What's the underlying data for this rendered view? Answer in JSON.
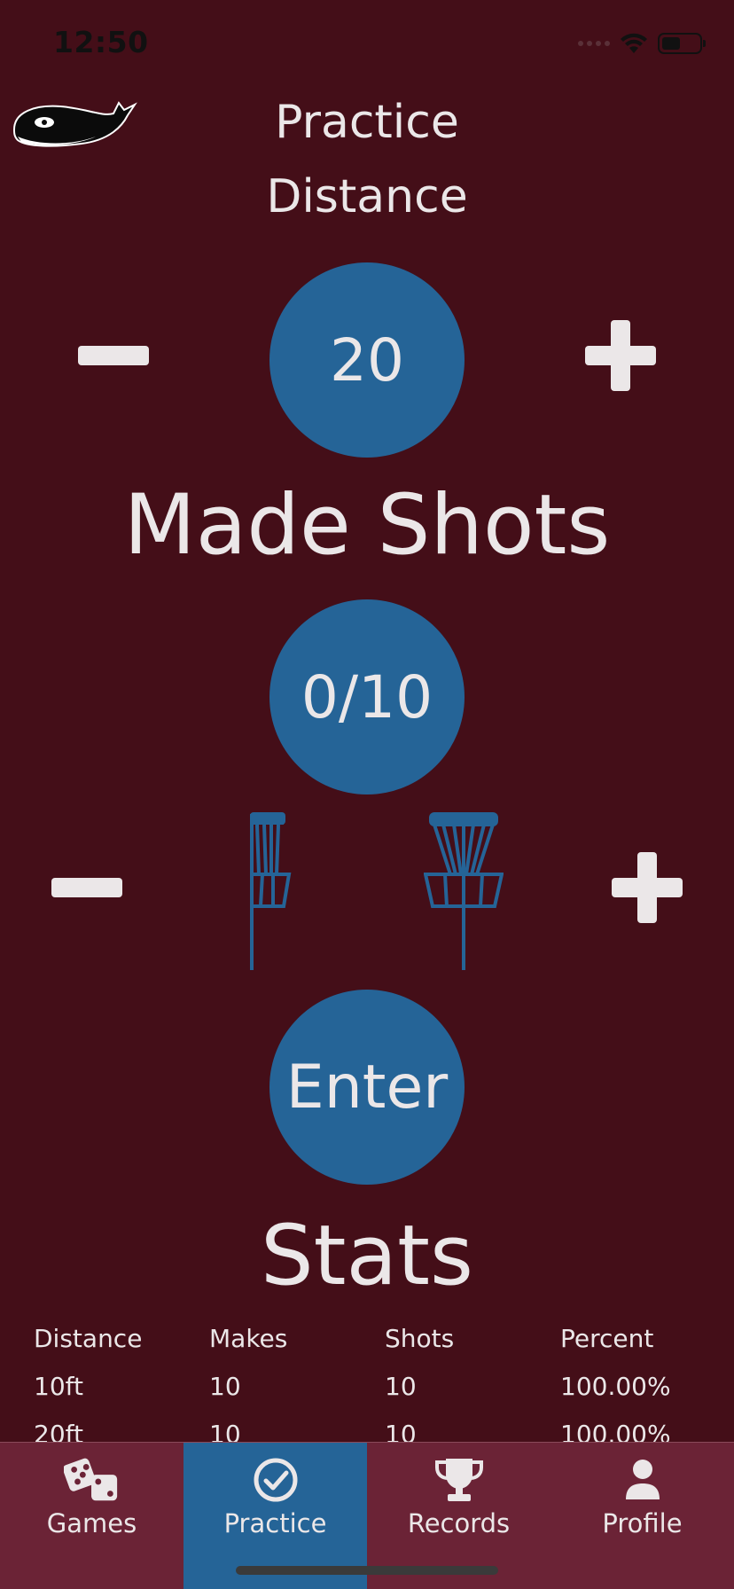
{
  "status_bar": {
    "time": "12:50"
  },
  "header": {
    "logo": "whale-logo",
    "title": "Practice",
    "subtitle": "Distance"
  },
  "distance": {
    "value": "20"
  },
  "made_shots": {
    "heading": "Made Shots",
    "value": "0/10"
  },
  "enter_button": {
    "label": "Enter"
  },
  "stats": {
    "heading": "Stats",
    "columns": [
      "Distance",
      "Makes",
      "Shots",
      "Percent"
    ],
    "rows": [
      [
        "10ft",
        "10",
        "10",
        "100.00%"
      ],
      [
        "20ft",
        "10",
        "10",
        "100.00%"
      ]
    ]
  },
  "tabs": [
    {
      "label": "Games",
      "icon": "dice-icon",
      "active": false
    },
    {
      "label": "Practice",
      "icon": "check-circle-icon",
      "active": true
    },
    {
      "label": "Records",
      "icon": "trophy-icon",
      "active": false
    },
    {
      "label": "Profile",
      "icon": "person-icon",
      "active": false
    }
  ],
  "colors": {
    "background": "#440e18",
    "accent_blue": "#256497",
    "tabbar": "#6b2336",
    "text": "#ebe7e8"
  }
}
